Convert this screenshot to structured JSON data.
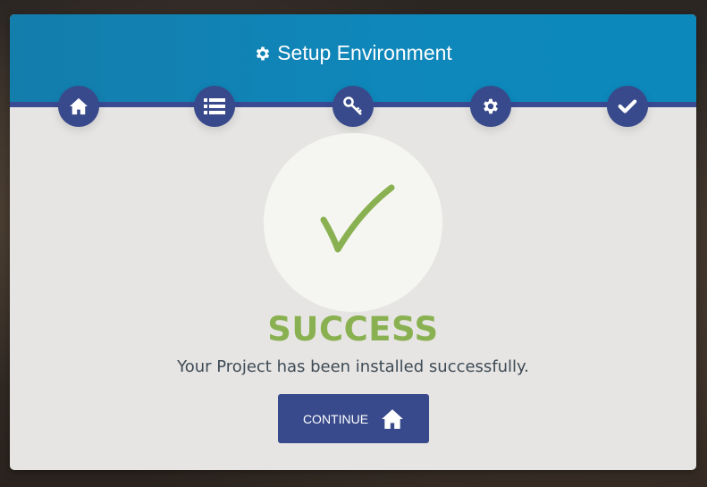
{
  "header": {
    "title": "Setup Environment",
    "title_icon": "gear-icon"
  },
  "steps": [
    {
      "icon": "home-icon"
    },
    {
      "icon": "list-icon"
    },
    {
      "icon": "key-icon"
    },
    {
      "icon": "gear-icon"
    },
    {
      "icon": "checkmark-icon"
    }
  ],
  "result": {
    "status": "SUCCESS",
    "message": "Your Project has been installed successfully.",
    "icon": "checkmark-icon"
  },
  "actions": {
    "continue_label": "CONTINUE",
    "continue_icon": "home-icon"
  },
  "colors": {
    "header": "#0f87ba",
    "accent": "#384a8b",
    "success": "#8ab151",
    "card": "#e6e5e3"
  }
}
